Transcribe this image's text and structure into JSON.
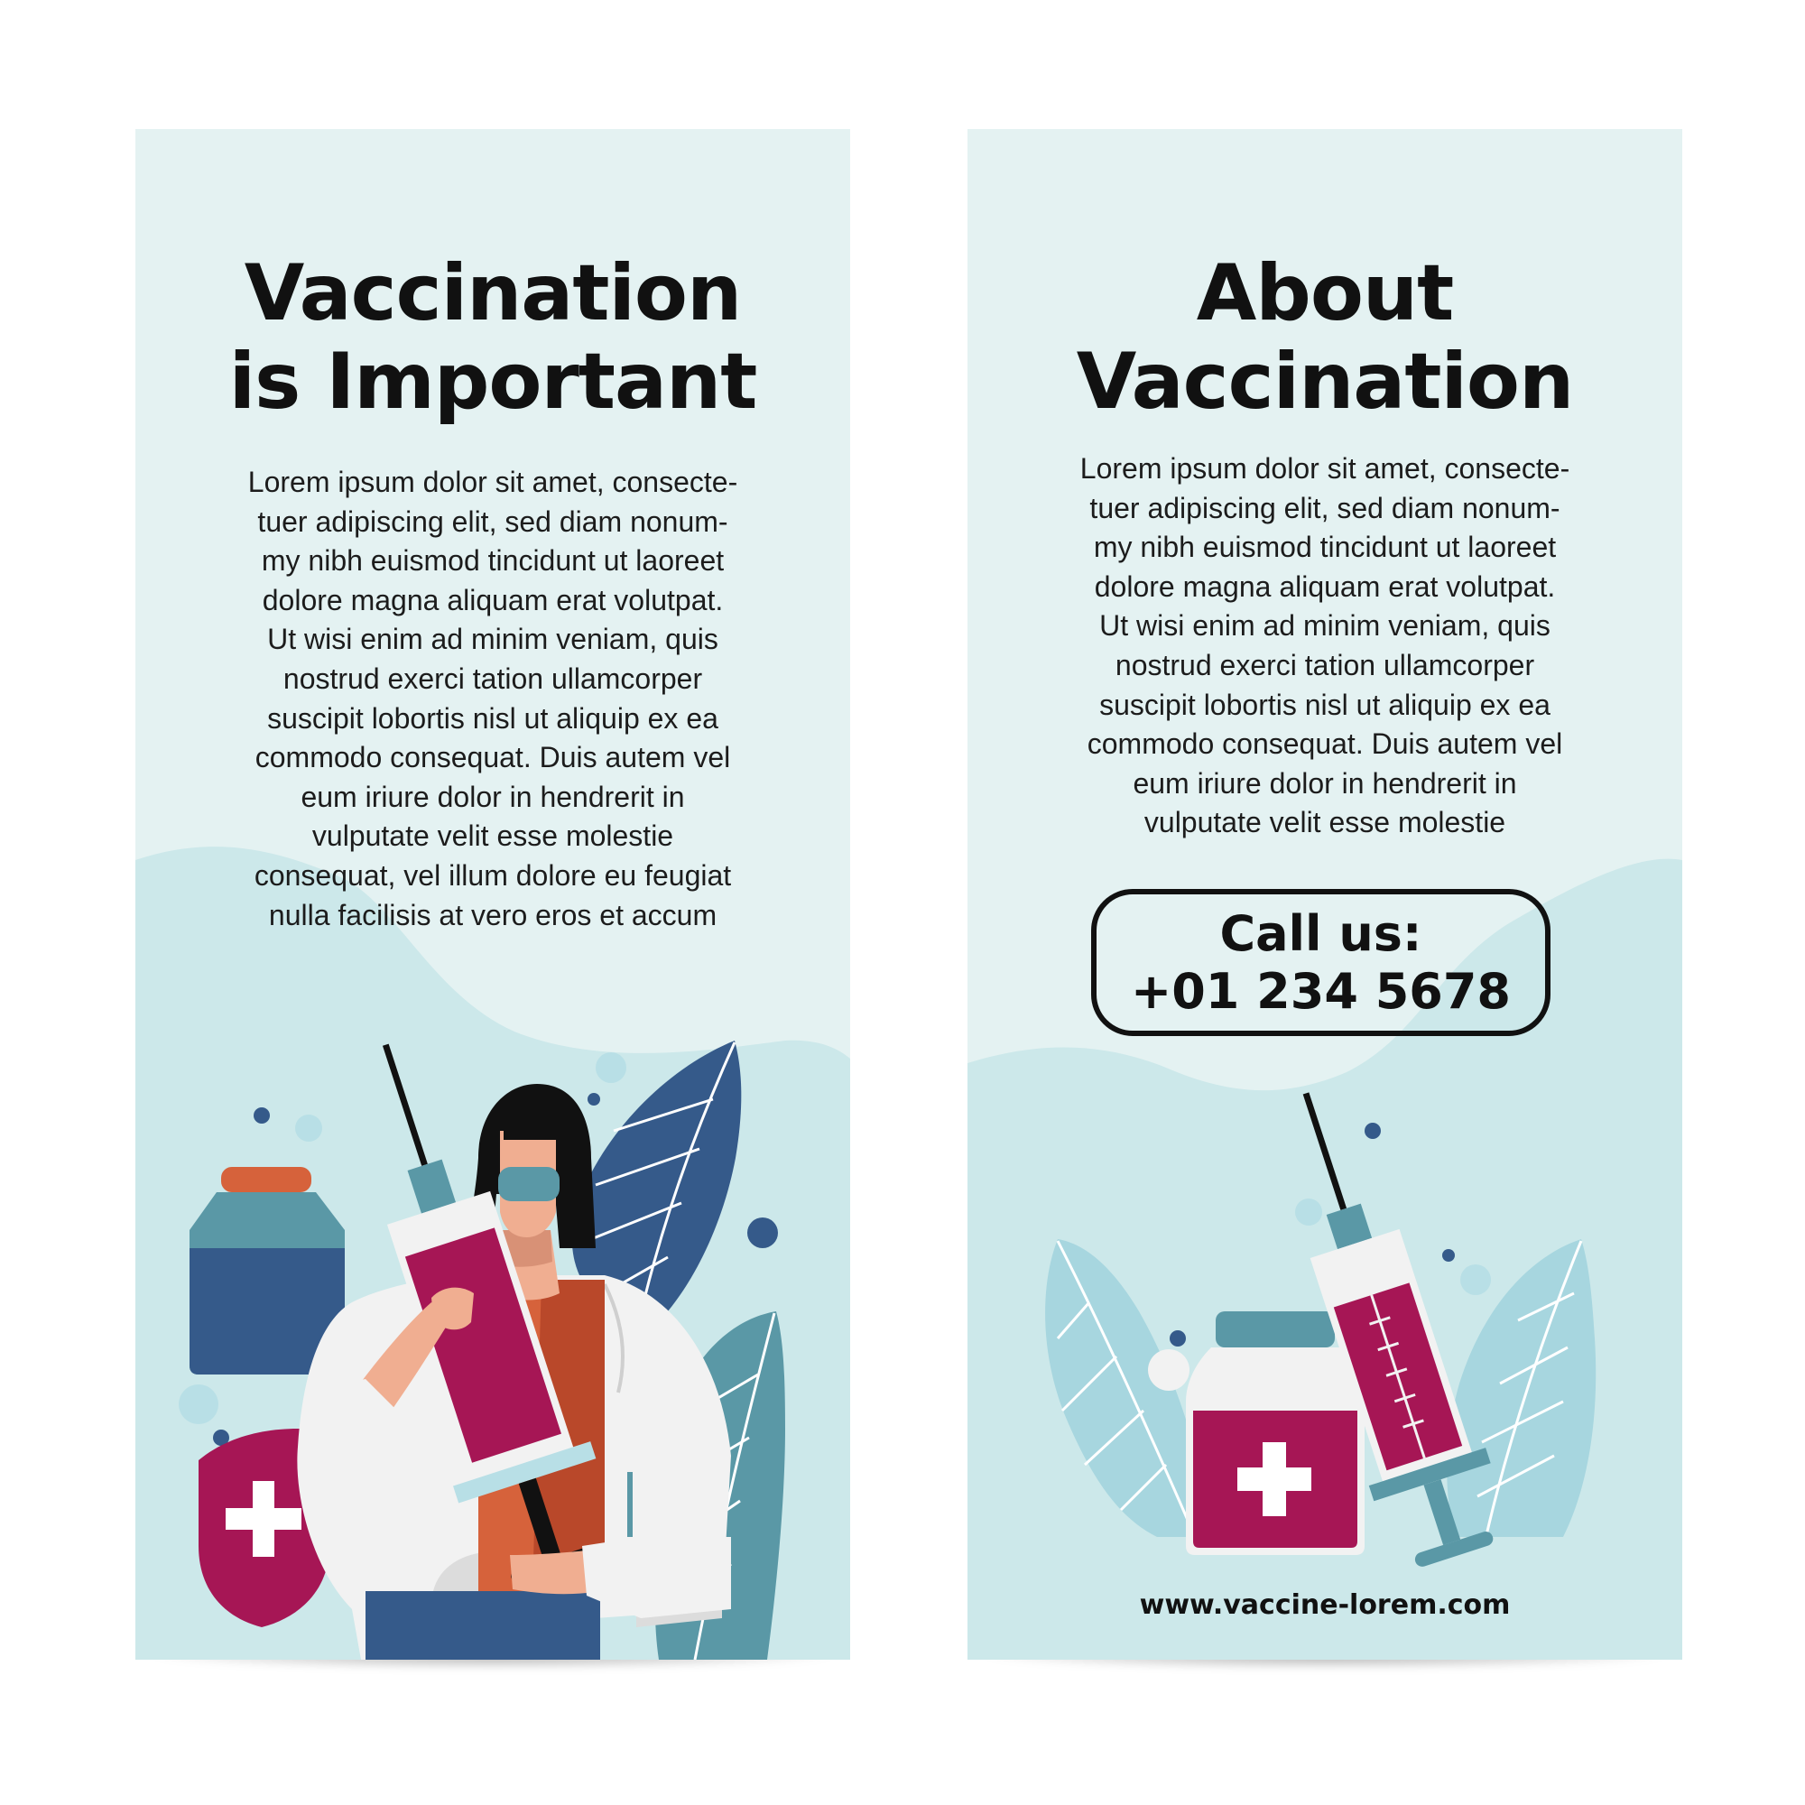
{
  "left_panel": {
    "title_lines": [
      "Vaccination",
      "is Important"
    ],
    "body_lines": [
      "Lorem ipsum dolor sit amet, consecte-",
      "tuer adipiscing elit, sed diam nonum-",
      "my nibh euismod tincidunt ut laoreet",
      "dolore magna aliquam erat volutpat.",
      "Ut wisi enim ad minim veniam, quis",
      "nostrud exerci tation ullamcorper",
      "suscipit lobortis nisl ut aliquip ex ea",
      "commodo consequat. Duis autem vel",
      "eum iriure dolor in hendrerit in",
      "vulputate velit esse molestie",
      "consequat, vel illum dolore eu feugiat",
      "nulla facilisis at vero eros et accum"
    ]
  },
  "right_panel": {
    "title_lines": [
      "About",
      "Vaccination"
    ],
    "body_lines": [
      "Lorem ipsum dolor sit amet, consecte-",
      "tuer adipiscing elit, sed diam nonum-",
      "my nibh euismod tincidunt ut laoreet",
      "dolore magna aliquam erat volutpat.",
      "Ut wisi enim ad minim veniam, quis",
      "nostrud exerci tation ullamcorper",
      "suscipit lobortis nisl ut aliquip ex ea",
      "commodo consequat. Duis autem vel",
      "eum iriure dolor in hendrerit in",
      "vulputate velit esse molestie"
    ],
    "call_label": "Call us:",
    "phone": "+01 234 5678",
    "website": "www.vaccine-lorem.com"
  },
  "colors": {
    "panel_light": "#e4f2f2",
    "panel_mid": "#cce8ea",
    "teal": "#5a98a6",
    "navy": "#355a8a",
    "magenta": "#a61655",
    "orange": "#d6623b",
    "skin": "#f0ae91",
    "coat": "#f2f2f2",
    "text": "#111111"
  },
  "icons": [
    "syringe-icon",
    "vaccine-vial-icon",
    "medical-cross-icon",
    "leaf-icon",
    "doctor-illustration"
  ]
}
